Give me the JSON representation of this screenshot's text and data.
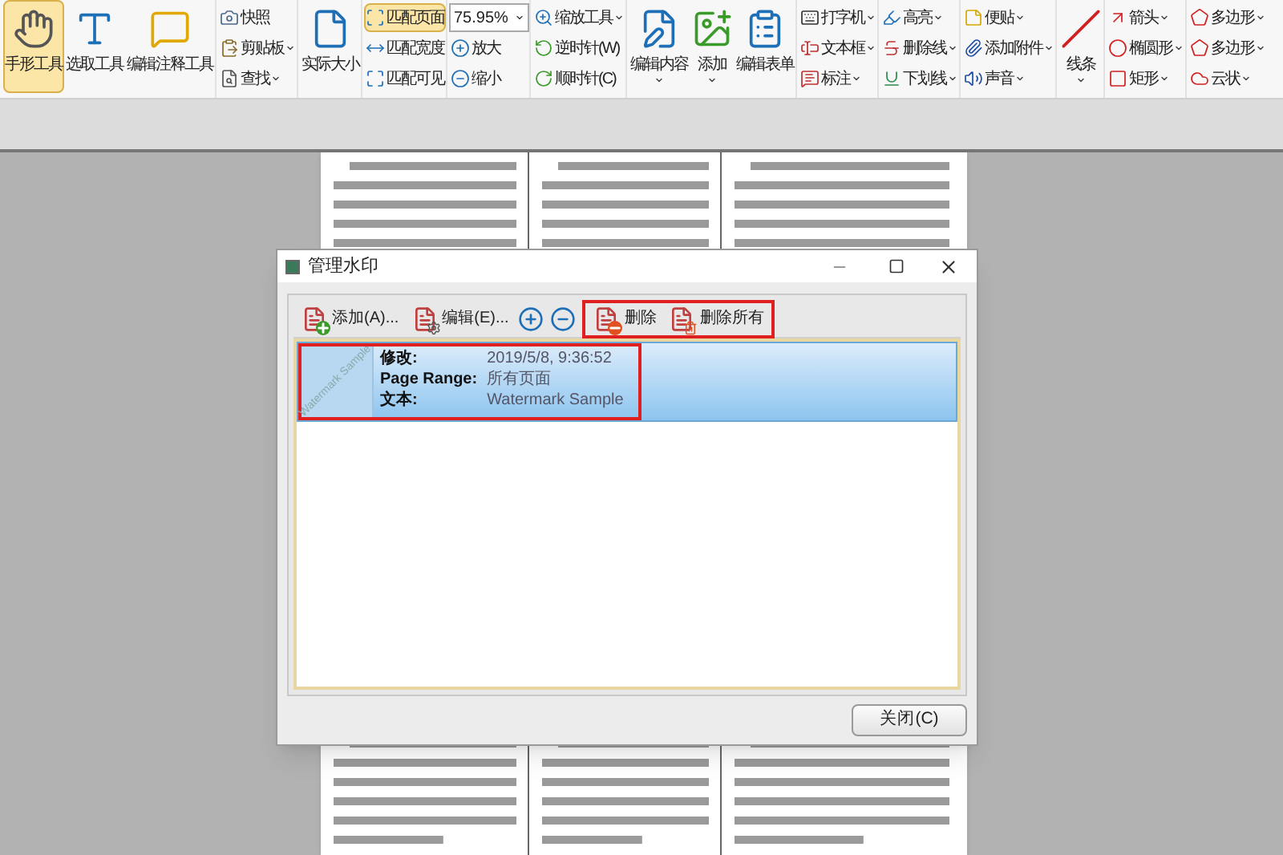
{
  "toolbar": {
    "groups": [
      {
        "kind": "large",
        "items": [
          {
            "label": "手形工具",
            "selected": true,
            "dropdown": false
          },
          {
            "label": "选取工具",
            "selected": false,
            "dropdown": false
          },
          {
            "label": "编辑注释工具",
            "selected": false,
            "dropdown": false
          }
        ]
      },
      {
        "kind": "stack",
        "items": [
          {
            "label": "快照",
            "selected": false,
            "dropdown": false
          },
          {
            "label": "剪贴板",
            "selected": false,
            "dropdown": true
          },
          {
            "label": "查找",
            "selected": false,
            "dropdown": true
          }
        ]
      },
      {
        "kind": "large",
        "items": [
          {
            "label": "实际大小",
            "selected": false,
            "dropdown": false
          }
        ]
      },
      {
        "kind": "stack",
        "items": [
          {
            "label": "匹配页面",
            "selected": true,
            "dropdown": false
          },
          {
            "label": "匹配宽度",
            "selected": false,
            "dropdown": false
          },
          {
            "label": "匹配可见",
            "selected": false,
            "dropdown": false
          }
        ]
      },
      {
        "kind": "zoom",
        "value": "75.95%",
        "items": [
          {
            "label": "放大",
            "selected": false,
            "dropdown": false
          },
          {
            "label": "缩小",
            "selected": false,
            "dropdown": false
          }
        ]
      },
      {
        "kind": "stack",
        "items": [
          {
            "label": "缩放工具",
            "selected": false,
            "dropdown": true
          },
          {
            "label": "逆时针(W)",
            "selected": false,
            "dropdown": false
          },
          {
            "label": "顺时针(C)",
            "selected": false,
            "dropdown": false
          }
        ]
      },
      {
        "kind": "large",
        "items": [
          {
            "label": "编辑内容",
            "selected": false,
            "dropdown": true
          },
          {
            "label": "添加",
            "selected": false,
            "dropdown": true
          },
          {
            "label": "编辑表单",
            "selected": false,
            "dropdown": false
          }
        ]
      },
      {
        "kind": "stack",
        "items": [
          {
            "label": "打字机",
            "selected": false,
            "dropdown": true
          },
          {
            "label": "文本框",
            "selected": false,
            "dropdown": true
          },
          {
            "label": "标注",
            "selected": false,
            "dropdown": true
          }
        ]
      },
      {
        "kind": "stack",
        "items": [
          {
            "label": "高亮",
            "selected": false,
            "dropdown": true
          },
          {
            "label": "删除线",
            "selected": false,
            "dropdown": true
          },
          {
            "label": "下划线",
            "selected": false,
            "dropdown": true
          }
        ]
      },
      {
        "kind": "stack",
        "items": [
          {
            "label": "便贴",
            "selected": false,
            "dropdown": true
          },
          {
            "label": "添加附件",
            "selected": false,
            "dropdown": true
          },
          {
            "label": "声音",
            "selected": false,
            "dropdown": true
          }
        ]
      },
      {
        "kind": "large",
        "items": [
          {
            "label": "线条",
            "selected": false,
            "dropdown": true
          }
        ]
      },
      {
        "kind": "stack",
        "items": [
          {
            "label": "箭头",
            "selected": false,
            "dropdown": true
          },
          {
            "label": "椭圆形",
            "selected": false,
            "dropdown": true
          },
          {
            "label": "矩形",
            "selected": false,
            "dropdown": true
          }
        ]
      },
      {
        "kind": "stack",
        "items": [
          {
            "label": "多边形",
            "selected": false,
            "dropdown": true
          },
          {
            "label": "多边形",
            "selected": false,
            "dropdown": true
          },
          {
            "label": "云状",
            "selected": false,
            "dropdown": true
          }
        ]
      }
    ]
  },
  "dialog": {
    "title": "管理水印",
    "toolbar": [
      {
        "kind": "add",
        "label": "添加(A)..."
      },
      {
        "kind": "edit",
        "label": "编辑(E)..."
      },
      {
        "kind": "zoom-in"
      },
      {
        "kind": "zoom-out"
      },
      {
        "kind": "delete",
        "label": "删除"
      },
      {
        "kind": "delete-all",
        "label": "删除所有"
      }
    ],
    "watermarks": [
      {
        "selected": true,
        "thumbnail_text": "Watermark Sample",
        "fields": [
          {
            "label": "修改:",
            "value": "2019/5/8, 9:36:52"
          },
          {
            "label": "Page Range:",
            "value": "所有页面"
          },
          {
            "label": "文本:",
            "value": "Watermark Sample"
          }
        ]
      }
    ],
    "close_button": "关闭(C)"
  }
}
